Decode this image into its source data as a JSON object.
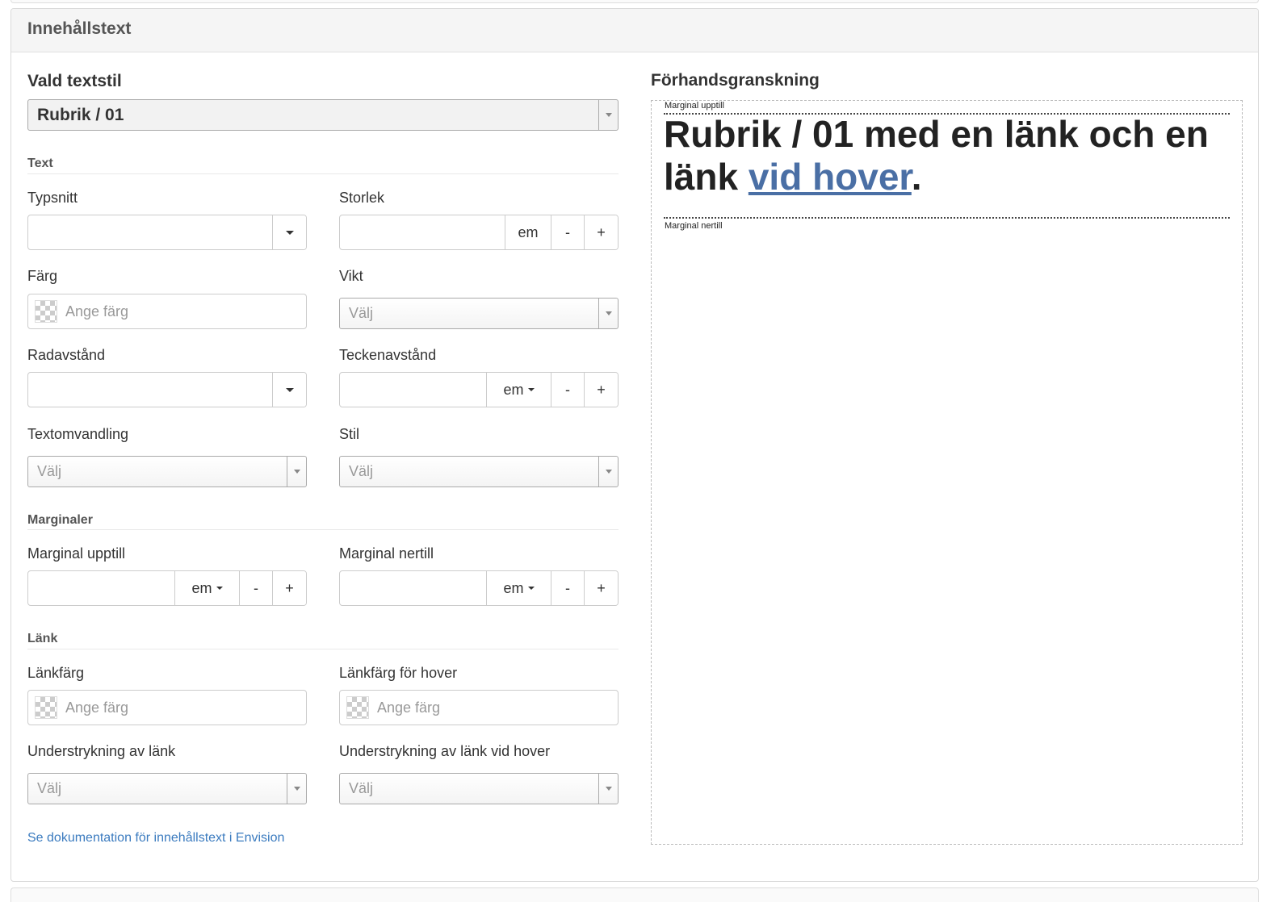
{
  "panel": {
    "title": "Innehållstext"
  },
  "left": {
    "selected_style_label": "Vald textstil",
    "selected_style_value": "Rubrik / 01",
    "sections": {
      "text": "Text",
      "margins": "Marginaler",
      "link": "Länk"
    },
    "fields": {
      "font": {
        "label": "Typsnitt"
      },
      "size": {
        "label": "Storlek",
        "unit": "em",
        "minus": "-",
        "plus": "+"
      },
      "color": {
        "label": "Färg",
        "placeholder": "Ange färg"
      },
      "weight": {
        "label": "Vikt",
        "value": "Välj"
      },
      "line_height": {
        "label": "Radavstånd"
      },
      "letter_spacing": {
        "label": "Teckenavstånd",
        "unit": "em",
        "minus": "-",
        "plus": "+"
      },
      "text_transform": {
        "label": "Textomvandling",
        "value": "Välj"
      },
      "style": {
        "label": "Stil",
        "value": "Välj"
      },
      "margin_top": {
        "label": "Marginal upptill",
        "unit": "em",
        "minus": "-",
        "plus": "+"
      },
      "margin_bottom": {
        "label": "Marginal nertill",
        "unit": "em",
        "minus": "-",
        "plus": "+"
      },
      "link_color": {
        "label": "Länkfärg",
        "placeholder": "Ange färg"
      },
      "link_hover_color": {
        "label": "Länkfärg för hover",
        "placeholder": "Ange färg"
      },
      "link_underline": {
        "label": "Understrykning av länk",
        "value": "Välj"
      },
      "link_hover_underline": {
        "label": "Understrykning av länk vid hover",
        "value": "Välj"
      }
    },
    "doc_link": "Se dokumentation för innehållstext i Envision"
  },
  "preview": {
    "title": "Förhandsgranskning",
    "margin_top_note": "Marginal upptill",
    "margin_bottom_note": "Marginal nertill",
    "heading_start": "Rubrik / 01 med en länk och en länk ",
    "heading_link": "vid hover",
    "heading_end": ".",
    "link_color": "#4a6fa5"
  }
}
